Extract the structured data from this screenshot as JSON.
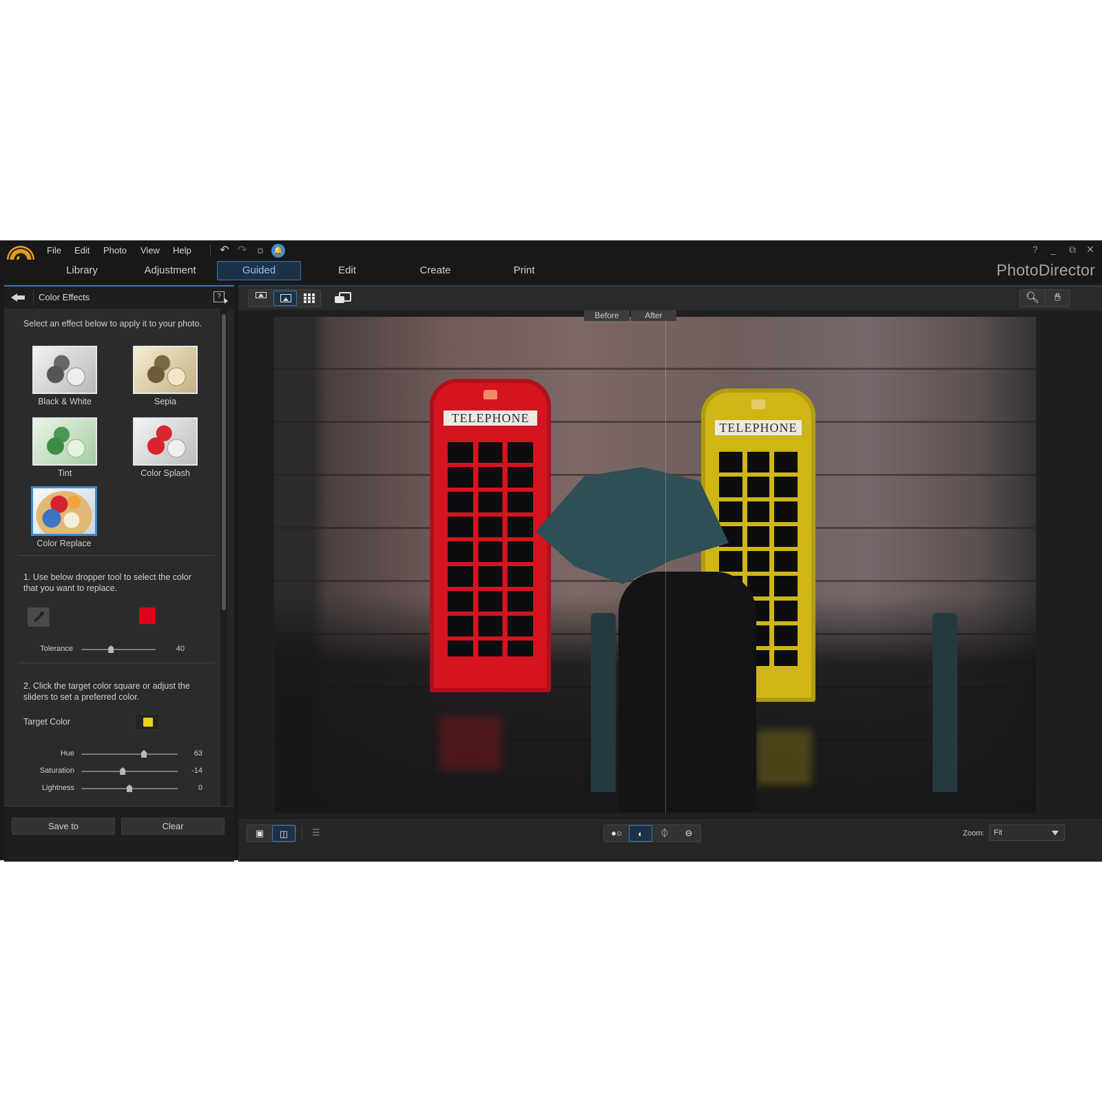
{
  "app": {
    "brand": "PhotoDirector",
    "menu": [
      "File",
      "Edit",
      "Photo",
      "View",
      "Help"
    ],
    "top_icons": [
      "undo-icon",
      "redo-icon",
      "settings-icon",
      "notification-bell-icon"
    ],
    "window_controls": {
      "help": "?",
      "minimize": "_",
      "restore": "⧉",
      "close": "✕"
    },
    "modes": [
      {
        "label": "Library",
        "active": false
      },
      {
        "label": "Adjustment",
        "active": false
      },
      {
        "label": "Guided",
        "active": true
      },
      {
        "label": "Edit",
        "active": false
      },
      {
        "label": "Create",
        "active": false
      },
      {
        "label": "Print",
        "active": false
      }
    ],
    "accent_color": "#3d76ae"
  },
  "panel": {
    "title": "Color Effects",
    "help_label": "?",
    "intro": "Select an effect below to apply it to your photo.",
    "effects": [
      {
        "label": "Black & White",
        "selected": false
      },
      {
        "label": "Sepia",
        "selected": false
      },
      {
        "label": "Tint",
        "selected": false
      },
      {
        "label": "Color Splash",
        "selected": false
      },
      {
        "label": "Color Replace",
        "selected": true
      }
    ],
    "step1": "1. Use below dropper tool to select the color that you want to replace.",
    "source_color": "#e0001c",
    "tolerance": {
      "label": "Tolerance",
      "value": "40",
      "fraction": 0.4
    },
    "step2": "2. Click the target color square or adjust the sliders to set a preferred color.",
    "target_color_label": "Target Color",
    "target_color": "#e8d41a",
    "sliders": [
      {
        "label": "Hue",
        "value": "63",
        "fraction": 0.65
      },
      {
        "label": "Saturation",
        "value": "-14",
        "fraction": 0.43
      },
      {
        "label": "Lightness",
        "value": "0",
        "fraction": 0.5
      }
    ],
    "footer": {
      "save_label": "Save to",
      "clear_label": "Clear"
    }
  },
  "viewer": {
    "before_label": "Before",
    "after_label": "After",
    "booth_sign_text": "TELEPHONE",
    "zoom_label": "Zoom:",
    "zoom_value": "Fit"
  }
}
